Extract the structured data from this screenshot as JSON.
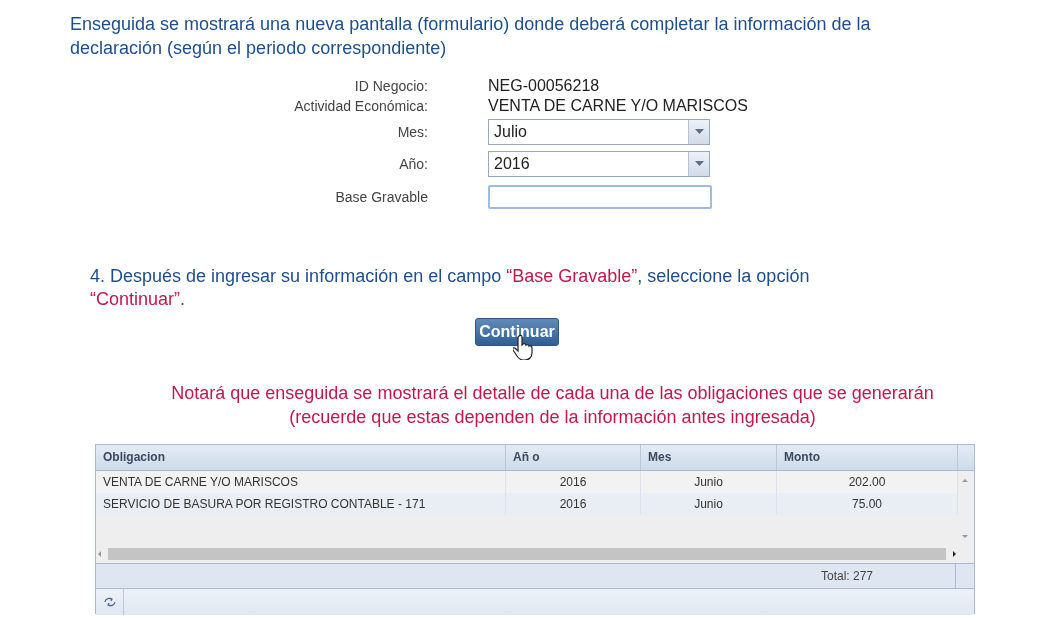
{
  "intro": "Enseguida se mostrará una nueva pantalla (formulario) donde deberá completar la información de la declaración (según el periodo correspondiente)",
  "form": {
    "fields": [
      {
        "kind": "static",
        "label": "ID Negocio:",
        "value": "NEG-00056218"
      },
      {
        "kind": "static",
        "label": "Actividad Económica:",
        "value": "VENTA DE CARNE Y/O MARISCOS"
      },
      {
        "kind": "select",
        "label": "Mes:",
        "value": "Julio"
      },
      {
        "kind": "select",
        "label": "Año:",
        "value": "2016"
      },
      {
        "kind": "input",
        "label": "Base Gravable"
      }
    ]
  },
  "step": [
    {
      "text": "4. Después de ingresar su información en el campo ",
      "kind": "plain"
    },
    {
      "text": "“Base Gravable”",
      "kind": "highlight"
    },
    {
      "text": ", seleccione la opción ",
      "kind": "plain"
    },
    {
      "text": "“Continuar”",
      "kind": "highlight"
    },
    {
      "text": ".",
      "kind": "plain"
    }
  ],
  "continue_button": "Continuar",
  "note": "Notará que enseguida se mostrará el detalle de cada una de las obligaciones que se generarán (recuerde que estas dependen de la información antes ingresada)",
  "table": {
    "columns": [
      "Obligacion",
      "Añ o",
      "Mes",
      "Monto"
    ],
    "rows": [
      [
        "VENTA DE CARNE Y/O MARISCOS",
        "2016",
        "Junio",
        "202.00"
      ],
      [
        "SERVICIO DE BASURA POR REGISTRO CONTABLE - 171",
        "2016",
        "Junio",
        "75.00"
      ]
    ],
    "total": "Total: 277"
  }
}
